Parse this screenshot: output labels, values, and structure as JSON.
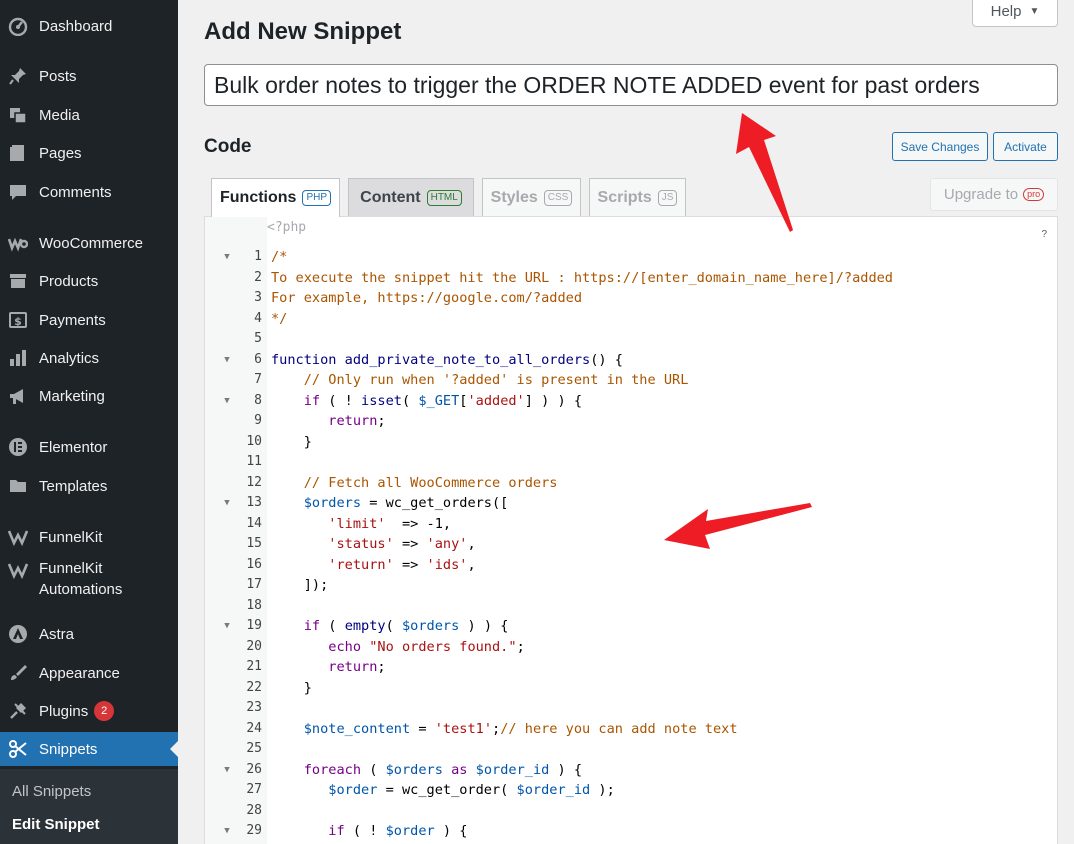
{
  "sidebar": {
    "items": [
      {
        "label": "Dashboard",
        "icon": "dashboard-icon"
      },
      {
        "label": "Posts",
        "icon": "pin-icon"
      },
      {
        "label": "Media",
        "icon": "media-icon"
      },
      {
        "label": "Pages",
        "icon": "pages-icon"
      },
      {
        "label": "Comments",
        "icon": "comments-icon"
      },
      {
        "label": "WooCommerce",
        "icon": "woocommerce-icon"
      },
      {
        "label": "Products",
        "icon": "archive-icon"
      },
      {
        "label": "Payments",
        "icon": "dollar-icon"
      },
      {
        "label": "Analytics",
        "icon": "bar-chart-icon"
      },
      {
        "label": "Marketing",
        "icon": "megaphone-icon"
      },
      {
        "label": "Elementor",
        "icon": "elementor-icon"
      },
      {
        "label": "Templates",
        "icon": "folder-icon"
      },
      {
        "label": "FunnelKit",
        "icon": "funnelkit-icon"
      },
      {
        "label": "FunnelKit Automations",
        "icon": "funnelkit-icon"
      },
      {
        "label": "Astra",
        "icon": "astra-icon"
      },
      {
        "label": "Appearance",
        "icon": "paintbrush-icon"
      },
      {
        "label": "Plugins",
        "icon": "plug-icon",
        "badge": "2"
      },
      {
        "label": "Snippets",
        "icon": "scissors-icon"
      }
    ],
    "submenu": [
      "All Snippets",
      "Edit Snippet"
    ]
  },
  "page": {
    "title": "Add New Snippet",
    "help_label": "Help",
    "snippet_title": "Bulk order notes to trigger the ORDER NOTE ADDED event for past orders",
    "code_heading": "Code",
    "save_label": "Save Changes",
    "activate_label": "Activate"
  },
  "tabs": [
    {
      "label": "Functions",
      "tag": "PHP"
    },
    {
      "label": "Content",
      "tag": "HTML"
    },
    {
      "label": "Styles",
      "tag": "CSS"
    },
    {
      "label": "Scripts",
      "tag": "JS"
    }
  ],
  "upgrade": {
    "label": "Upgrade to",
    "badge": "pro"
  },
  "editor": {
    "php_open": "<?php",
    "help_glyph": "?",
    "lines": [
      {
        "n": "1",
        "fold": true,
        "tokens": [
          [
            "c",
            "/*"
          ]
        ]
      },
      {
        "n": "2",
        "tokens": [
          [
            "c",
            "To execute the snippet hit the URL : https://[enter_domain_name_here]/?added"
          ]
        ]
      },
      {
        "n": "3",
        "tokens": [
          [
            "c",
            "For example, https://google.com/?added"
          ]
        ]
      },
      {
        "n": "4",
        "tokens": [
          [
            "c",
            "*/"
          ]
        ]
      },
      {
        "n": "5",
        "tokens": []
      },
      {
        "n": "6",
        "fold": true,
        "tokens": [
          [
            "k2",
            "function"
          ],
          [
            "",
            " "
          ],
          [
            "fn",
            "add_private_note_to_all_orders"
          ],
          [
            "",
            "() {"
          ]
        ]
      },
      {
        "n": "7",
        "tokens": [
          [
            "",
            "    "
          ],
          [
            "c",
            "// Only run when '?added' is present in the URL"
          ]
        ]
      },
      {
        "n": "8",
        "fold": true,
        "tokens": [
          [
            "",
            "    "
          ],
          [
            "k",
            "if"
          ],
          [
            "",
            " ( ! "
          ],
          [
            "k2",
            "isset"
          ],
          [
            "",
            "( "
          ],
          [
            "v",
            "$_GET"
          ],
          [
            "",
            "["
          ],
          [
            "s",
            "'added'"
          ],
          [
            "",
            "] ) ) {"
          ]
        ]
      },
      {
        "n": "9",
        "tokens": [
          [
            "",
            "       "
          ],
          [
            "k",
            "return"
          ],
          [
            "",
            ";"
          ]
        ]
      },
      {
        "n": "10",
        "tokens": [
          [
            "",
            "    }"
          ]
        ]
      },
      {
        "n": "11",
        "tokens": []
      },
      {
        "n": "12",
        "tokens": [
          [
            "",
            "    "
          ],
          [
            "c",
            "// Fetch all WooCommerce orders"
          ]
        ]
      },
      {
        "n": "13",
        "fold": true,
        "tokens": [
          [
            "",
            "    "
          ],
          [
            "v",
            "$orders"
          ],
          [
            "",
            " = wc_get_orders(["
          ]
        ]
      },
      {
        "n": "14",
        "tokens": [
          [
            "",
            "       "
          ],
          [
            "s",
            "'limit'"
          ],
          [
            "",
            "  => -1,"
          ]
        ]
      },
      {
        "n": "15",
        "tokens": [
          [
            "",
            "       "
          ],
          [
            "s",
            "'status'"
          ],
          [
            "",
            " => "
          ],
          [
            "s",
            "'any'"
          ],
          [
            "",
            ","
          ]
        ]
      },
      {
        "n": "16",
        "tokens": [
          [
            "",
            "       "
          ],
          [
            "s",
            "'return'"
          ],
          [
            "",
            " => "
          ],
          [
            "s",
            "'ids'"
          ],
          [
            "",
            ","
          ]
        ]
      },
      {
        "n": "17",
        "tokens": [
          [
            "",
            "    ]);"
          ]
        ]
      },
      {
        "n": "18",
        "tokens": []
      },
      {
        "n": "19",
        "fold": true,
        "tokens": [
          [
            "",
            "    "
          ],
          [
            "k",
            "if"
          ],
          [
            "",
            " ( "
          ],
          [
            "k2",
            "empty"
          ],
          [
            "",
            "( "
          ],
          [
            "v",
            "$orders"
          ],
          [
            "",
            " ) ) {"
          ]
        ]
      },
      {
        "n": "20",
        "tokens": [
          [
            "",
            "       "
          ],
          [
            "k",
            "echo"
          ],
          [
            "",
            " "
          ],
          [
            "s",
            "\"No orders found.\""
          ],
          [
            "",
            ";"
          ]
        ]
      },
      {
        "n": "21",
        "tokens": [
          [
            "",
            "       "
          ],
          [
            "k",
            "return"
          ],
          [
            "",
            ";"
          ]
        ]
      },
      {
        "n": "22",
        "tokens": [
          [
            "",
            "    }"
          ]
        ]
      },
      {
        "n": "23",
        "tokens": []
      },
      {
        "n": "24",
        "tokens": [
          [
            "",
            "    "
          ],
          [
            "v",
            "$note_content"
          ],
          [
            "",
            " = "
          ],
          [
            "s",
            "'test1'"
          ],
          [
            "",
            ";"
          ],
          [
            "c",
            "// here you can add note text"
          ]
        ]
      },
      {
        "n": "25",
        "tokens": []
      },
      {
        "n": "26",
        "fold": true,
        "tokens": [
          [
            "",
            "    "
          ],
          [
            "k",
            "foreach"
          ],
          [
            "",
            " ( "
          ],
          [
            "v",
            "$orders"
          ],
          [
            "",
            " "
          ],
          [
            "k",
            "as"
          ],
          [
            "",
            " "
          ],
          [
            "v",
            "$order_id"
          ],
          [
            "",
            " ) {"
          ]
        ]
      },
      {
        "n": "27",
        "tokens": [
          [
            "",
            "       "
          ],
          [
            "v",
            "$order"
          ],
          [
            "",
            " = wc_get_order( "
          ],
          [
            "v",
            "$order_id"
          ],
          [
            "",
            " );"
          ]
        ]
      },
      {
        "n": "28",
        "tokens": []
      },
      {
        "n": "29",
        "fold": true,
        "tokens": [
          [
            "",
            "       "
          ],
          [
            "k",
            "if"
          ],
          [
            "",
            " ( ! "
          ],
          [
            "v",
            "$order"
          ],
          [
            "",
            " ) {"
          ]
        ]
      }
    ]
  },
  "annotation_color": "#ee1c24"
}
